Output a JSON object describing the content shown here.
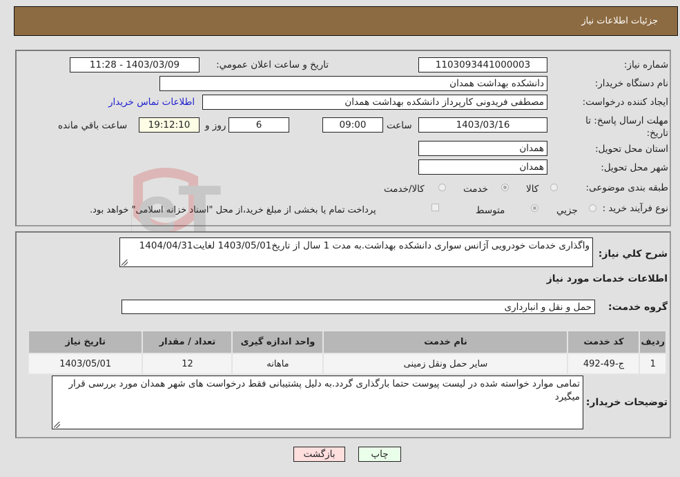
{
  "header": {
    "title": "جزئیات اطلاعات نیاز"
  },
  "info": {
    "need_number_label": "شماره نیاز:",
    "need_number": "1103093441000003",
    "announce_label": "تاریخ و ساعت اعلان عمومي:",
    "announce_value": "1403/03/09 - 11:28",
    "buyer_org_label": "نام دستگاه خريدار:",
    "buyer_org": "دانشکده بهداشت همدان",
    "creator_label": "ايجاد کننده درخواست:",
    "creator": "مصطفی فریدونی کارپرداز دانشکده بهداشت همدان",
    "contact_link": "اطلاعات تماس خريدار",
    "deadline_label": "مهلت ارسال پاسخ: تا تاریخ:",
    "deadline_date": "1403/03/16",
    "time_label": "ساعت",
    "deadline_time": "09:00",
    "days": "6",
    "days_label": "روز و",
    "remaining_time": "19:12:10",
    "remaining_label": "ساعت باقي مانده",
    "province_label": "استان محل تحویل:",
    "province": "همدان",
    "city_label": "شهر محل تحویل:",
    "city": "همدان",
    "category_label": "طبقه بندی موضوعی:",
    "category_options": [
      "کالا",
      "خدمت",
      "کالا/خدمت"
    ],
    "category_selected": "خدمت",
    "process_label": "نوع فرآیند خرید :",
    "process_options": [
      "جزيي",
      "متوسط"
    ],
    "process_selected": "متوسط",
    "payment_note": "پرداخت تمام یا بخشی از مبلغ خرید،از محل \"اسناد خزانه اسلامی\" خواهد بود."
  },
  "description": {
    "label": "شرح کلي نياز:",
    "text": "واگذاری خدمات خودرویی آژانس سواری دانشکده بهداشت.به مدت 1 سال از تاریخ1403/05/01 لغایت1404/04/31",
    "services_heading": "اطلاعات خدمات مورد نياز",
    "service_group_label": "گروه خدمت:",
    "service_group": "حمل و نقل و انبارداری"
  },
  "table": {
    "headers": [
      "رديف",
      "کد خدمت",
      "نام خدمت",
      "واحد اندازه گيری",
      "تعداد / مقدار",
      "تاريخ نياز"
    ],
    "rows": [
      [
        "1",
        "ج-49-492",
        "سایر حمل ونقل زمینی",
        "ماهانه",
        "12",
        "1403/05/01"
      ]
    ]
  },
  "buyer_notes": {
    "label": "توضيحات خريدار:",
    "text": "تمامی موارد خواسته شده در لیست پیوست حتما بارگذاری گردد.به دلیل پشتیبانی فقط درخواست های شهر همدان مورد بررسی قرار میگیرد"
  },
  "buttons": {
    "print": "چاپ",
    "back": "بازگشت"
  },
  "colors": {
    "header_bg": "#8d6b42",
    "print_bg": "#eaffea",
    "back_bg": "#ffdede",
    "link": "#2020d0"
  }
}
